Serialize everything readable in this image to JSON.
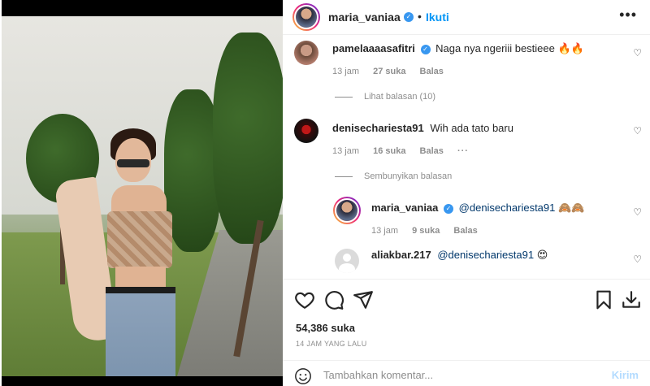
{
  "post": {
    "username": "maria_vaniaa",
    "verified_icon": "verified-badge-icon",
    "follow_label": "Ikuti",
    "more_icon": "more-options-icon"
  },
  "comments": [
    {
      "username": "pamelaaaasafitri",
      "verified": true,
      "text": "Naga nya ngeriii bestieee 🔥🔥",
      "time": "13 jam",
      "likes": "27 suka",
      "reply": "Balas",
      "view_replies": "Lihat balasan (10)"
    },
    {
      "username": "denisechariesta91",
      "verified": false,
      "text": "Wih ada tato baru",
      "time": "13 jam",
      "likes": "16 suka",
      "reply": "Balas",
      "hide_replies": "Sembunyikan balasan"
    }
  ],
  "replies": [
    {
      "username": "maria_vaniaa",
      "verified": true,
      "mention": "@denisechariesta91",
      "text": " 🙈🙈",
      "time": "13 jam",
      "likes": "9 suka",
      "reply": "Balas"
    },
    {
      "username": "aliakbar.217",
      "verified": false,
      "mention": "@denisechariesta91",
      "text": " 😍"
    }
  ],
  "actions": {
    "likes_count": "54,386 suka",
    "posted_time": "14 JAM YANG LALU"
  },
  "add_comment": {
    "placeholder": "Tambahkan komentar...",
    "send_label": "Kirim"
  },
  "colors": {
    "link_blue": "#0095f6",
    "mention_blue": "#00376b",
    "muted_gray": "#8e8e8e",
    "verified_blue": "#3897f0"
  }
}
